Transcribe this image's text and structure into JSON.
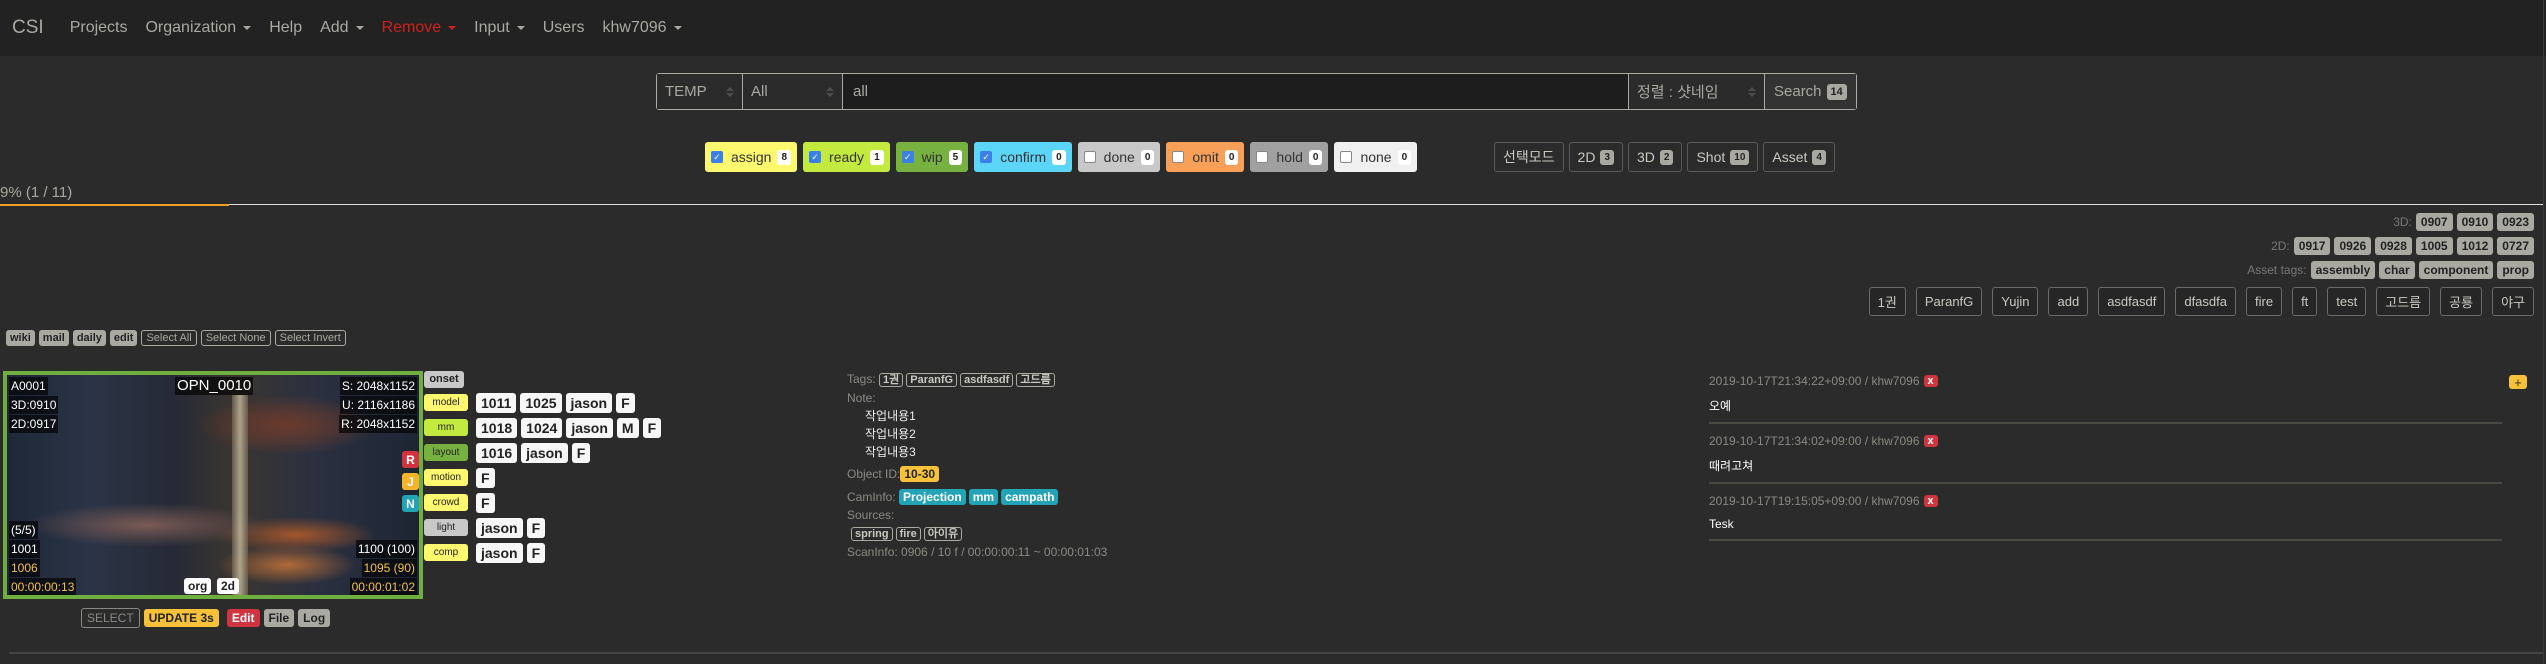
{
  "navbar": {
    "brand": "CSI",
    "items": [
      {
        "label": "Projects",
        "dropdown": false
      },
      {
        "label": "Organization",
        "dropdown": true
      },
      {
        "label": "Help",
        "dropdown": false
      },
      {
        "label": "Add",
        "dropdown": true
      },
      {
        "label": "Remove",
        "dropdown": true,
        "color": "#d0211c"
      },
      {
        "label": "Input",
        "dropdown": true
      },
      {
        "label": "Users",
        "dropdown": false
      },
      {
        "label": "khw7096",
        "dropdown": true
      }
    ]
  },
  "search": {
    "project": "TEMP",
    "scope": "All",
    "query": "all",
    "sort": "정렬 : 샷네임",
    "button_label": "Search",
    "result_count": "14"
  },
  "status_filters": [
    {
      "label": "assign",
      "count": "8",
      "checked": true,
      "color": "#fdf86d"
    },
    {
      "label": "ready",
      "count": "1",
      "checked": true,
      "color": "#c3ea3f"
    },
    {
      "label": "wip",
      "count": "5",
      "checked": true,
      "color": "#77b240"
    },
    {
      "label": "confirm",
      "count": "0",
      "checked": true,
      "color": "#5bd6f8"
    },
    {
      "label": "done",
      "count": "0",
      "checked": false,
      "color": "#c8c8c8"
    },
    {
      "label": "omit",
      "count": "0",
      "checked": false,
      "color": "#f8a058"
    },
    {
      "label": "hold",
      "count": "0",
      "checked": false,
      "color": "#a0a0a0"
    },
    {
      "label": "none",
      "count": "0",
      "checked": false,
      "color": "#f0f0f0"
    }
  ],
  "mode_buttons": [
    {
      "label": "선택모드",
      "count": null
    },
    {
      "label": "2D",
      "count": "3"
    },
    {
      "label": "3D",
      "count": "2"
    },
    {
      "label": "Shot",
      "count": "10"
    },
    {
      "label": "Asset",
      "count": "4"
    }
  ],
  "progress": {
    "label": "9% (1 / 11)",
    "percent": 9,
    "fill_color": "#f0a020"
  },
  "tag_info": {
    "3d_label": "3D:",
    "3d_tags": [
      "0907",
      "0910",
      "0923"
    ],
    "2d_label": "2D:",
    "2d_tags": [
      "0917",
      "0926",
      "0928",
      "1005",
      "1012",
      "0727"
    ],
    "asset_label": "Asset tags:",
    "asset_tags": [
      "assembly",
      "char",
      "component",
      "prop"
    ]
  },
  "tag_filters": [
    "1권",
    "ParanfG",
    "Yujin",
    "add",
    "asdfasdf",
    "dfasdfa",
    "fire",
    "ft",
    "test",
    "고드름",
    "공룡",
    "야구"
  ],
  "util": {
    "links": [
      "wiki",
      "mail",
      "daily",
      "edit"
    ],
    "select_all": "Select All",
    "select_none": "Select None",
    "select_invert": "Select Invert"
  },
  "item": {
    "name": "OPN_0010",
    "asset_id": "A0001",
    "tag_3d": "3D:0910",
    "tag_2d": "2D:0917",
    "size_s": "S: 2048x1152",
    "size_u": "U: 2116x1186",
    "size_r": "R: 2048x1152",
    "frames_count": "(5/5)",
    "frame_in": "1001",
    "frame_in_cut": "1006",
    "tc_in": "00:00:00:13",
    "frame_out": "1100 (100)",
    "frame_out_cut": "1095 (90)",
    "tc_out": "00:00:01:02",
    "thumb_tags": [
      "org",
      "2d"
    ],
    "side_badges": [
      {
        "label": "R",
        "color": "#d0353f"
      },
      {
        "label": "J",
        "color": "#f7b42a"
      },
      {
        "label": "N",
        "color": "#23a3b6"
      }
    ],
    "border_color": "#6fae3f",
    "actions": {
      "select": "SELECT",
      "update": "UPDATE 3s",
      "edit": "Edit",
      "file": "File",
      "log": "Log"
    },
    "onset": "onset",
    "pipeline": [
      {
        "task": "model",
        "color": "#fdf86d",
        "values": [
          "1011",
          "1025",
          "jason",
          "F"
        ]
      },
      {
        "task": "mm",
        "color": "#c3ea3f",
        "values": [
          "1018",
          "1024",
          "jason",
          "M",
          "F"
        ]
      },
      {
        "task": "layout",
        "color": "#77b240",
        "values": [
          "1016",
          "jason",
          "F"
        ]
      },
      {
        "task": "motion",
        "color": "#fdf86d",
        "values": [
          "F"
        ]
      },
      {
        "task": "crowd",
        "color": "#fdf86d",
        "values": [
          "F"
        ]
      },
      {
        "task": "light",
        "color": "#c8c8c8",
        "values": [
          "jason",
          "F"
        ]
      },
      {
        "task": "comp",
        "color": "#fdf86d",
        "values": [
          "jason",
          "F"
        ]
      }
    ],
    "info": {
      "tags_label": "Tags:",
      "tags": [
        "1권",
        "ParanfG",
        "asdfasdf",
        "고드름"
      ],
      "note_label": "Note:",
      "notes": [
        "작업내용1",
        "작업내용2",
        "작업내용3"
      ],
      "object_id_label": "Object ID:",
      "object_id": "10-30",
      "caminfo_label": "CamInfo:",
      "caminfo": [
        "Projection",
        "mm",
        "campath"
      ],
      "sources_label": "Sources:",
      "sources": [
        "spring",
        "fire",
        "아이유"
      ],
      "scaninfo": "ScanInfo: 0906 / 10 f / 00:00:00:11 ~ 00:00:01:03"
    },
    "comments": [
      {
        "meta": "2019-10-17T21:34:22+09:00 / khw7096",
        "body": "오예",
        "delete_label": "x"
      },
      {
        "meta": "2019-10-17T21:34:02+09:00 / khw7096",
        "body": "때려고쳐",
        "delete_label": "x"
      },
      {
        "meta": "2019-10-17T19:15:05+09:00 / khw7096",
        "body": "Tesk",
        "delete_label": "x"
      }
    ],
    "add_comment_label": "+"
  }
}
